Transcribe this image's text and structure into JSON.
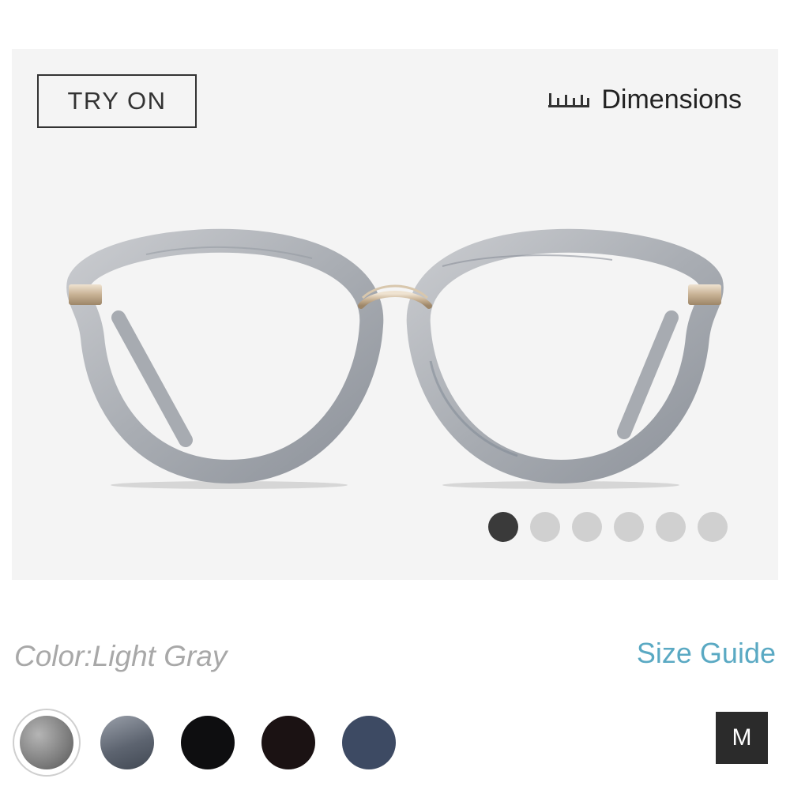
{
  "gallery": {
    "try_on_label": "TRY ON",
    "dimensions_label": "Dimensions",
    "dimensions_icon": "ruler-icon",
    "image_name": "round-eyeglasses-light-gray",
    "slide_count": 6,
    "active_slide": 1
  },
  "product": {
    "color_label": "Color:Light Gray",
    "size_guide_label": "Size Guide",
    "size_label": "M",
    "swatches": [
      {
        "name": "light-gray",
        "color": "#8f8f8f",
        "selected": true
      },
      {
        "name": "gray-blue",
        "color": "#6b717c",
        "selected": false
      },
      {
        "name": "black",
        "color": "#0e0e10",
        "selected": false
      },
      {
        "name": "dark-tortoise",
        "color": "#1b1213",
        "selected": false
      },
      {
        "name": "navy",
        "color": "#3d4a63",
        "selected": false
      }
    ]
  }
}
